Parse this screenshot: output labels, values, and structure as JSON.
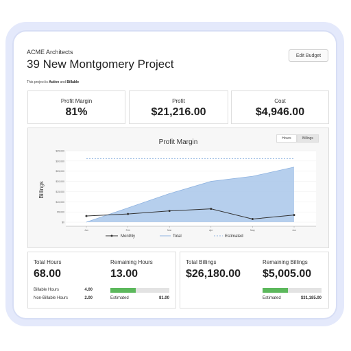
{
  "company": "ACME Architects",
  "project_title": "39 New Montgomery Project",
  "edit_button": "Edit Budget",
  "status": {
    "prefix": "This project is ",
    "active": "Active",
    "and": " and ",
    "billable": "Billable"
  },
  "kpis": [
    {
      "label": "Profit Margin",
      "value": "81%"
    },
    {
      "label": "Profit",
      "value": "$21,216.00"
    },
    {
      "label": "Cost",
      "value": "$4,946.00"
    }
  ],
  "chart": {
    "title": "Profit Margin",
    "toggle_hours": "Hours",
    "toggle_billings": "Billings",
    "ylabel": "Billings",
    "legend": {
      "monthly": "Monthly",
      "total": "Total",
      "estimated": "Estimated"
    }
  },
  "chart_data": {
    "type": "line",
    "title": "Profit Margin",
    "ylabel": "Billings",
    "x": [
      "Jan",
      "Feb",
      "Mar",
      "Apr",
      "May",
      "Jun"
    ],
    "yticks": [
      "$0",
      "$5,000",
      "$10,000",
      "$15,000",
      "$20,000",
      "$25,000",
      "$30,000",
      "$35,000"
    ],
    "ylim": [
      0,
      35000
    ],
    "series": [
      {
        "name": "Monthly",
        "kind": "line",
        "values": [
          3000,
          4000,
          5500,
          6500,
          1500,
          3500
        ]
      },
      {
        "name": "Total",
        "kind": "area",
        "values": [
          0,
          7000,
          14000,
          20000,
          22500,
          27000
        ]
      },
      {
        "name": "Estimated",
        "kind": "dashed",
        "values": [
          31185,
          31185,
          31185,
          31185,
          31185,
          31185
        ]
      }
    ],
    "colors": {
      "monthly": "#333333",
      "total": "#a9c7ea",
      "total_line": "#8fb3e0",
      "estimated": "#8fb3e0"
    }
  },
  "hours": {
    "total_label": "Total Hours",
    "total_value": "68.00",
    "remaining_label": "Remaining Hours",
    "remaining_value": "13.00",
    "billable_label": "Billable Hours",
    "billable_value": "4.00",
    "nonbillable_label": "Non-Billable Hours",
    "nonbillable_value": "2.00",
    "estimated_label": "Estimated",
    "estimated_value": "81.00",
    "progress_fraction": 0.43
  },
  "billings": {
    "total_label": "Total Billings",
    "total_value": "$26,180.00",
    "remaining_label": "Remaining Billings",
    "remaining_value": "$5,005.00",
    "estimated_label": "Estimated",
    "estimated_value": "$31,185.00",
    "progress_fraction": 0.43
  },
  "colors": {
    "progress": "#5cb85c",
    "frame": "#e4e9fb"
  }
}
